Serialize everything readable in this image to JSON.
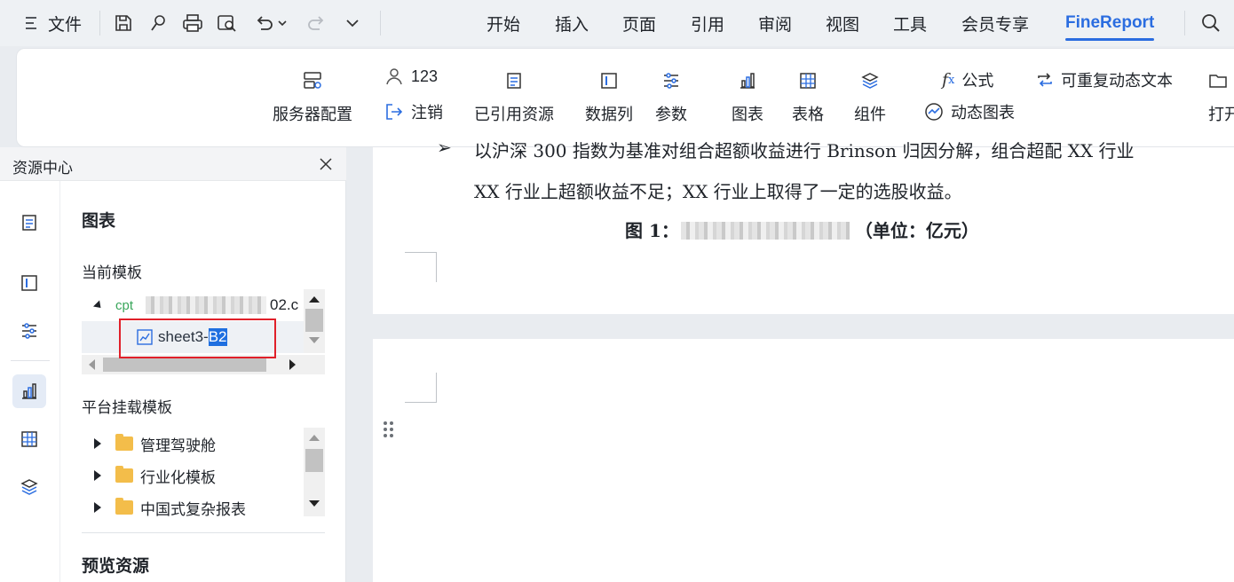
{
  "menubar": {
    "file_label": "文件",
    "tabs": [
      "开始",
      "插入",
      "页面",
      "引用",
      "审阅",
      "视图",
      "工具",
      "会员专享",
      "FineReport"
    ],
    "active_tab": "FineReport"
  },
  "ribbon": {
    "server_config": "服务器配置",
    "user_name": "123",
    "logout": "注销",
    "referenced_resources": "已引用资源",
    "data_column": "数据列",
    "parameter": "参数",
    "chart": "图表",
    "table": "表格",
    "component": "组件",
    "formula": "公式",
    "repeatable_dynamic_text": "可重复动态文本",
    "dynamic_chart": "动态图表",
    "open": "打开"
  },
  "panel": {
    "title": "资源中心",
    "section_title": "图表",
    "current_template_label": "当前模板",
    "cpt_tag": "cpt",
    "cpt_suffix": "02.c",
    "sheet_item_prefix": "sheet3-",
    "sheet_item_selected": "B2",
    "platform_label": "平台挂载模板",
    "folders": [
      "管理驾驶舱",
      "行业化模板",
      "中国式复杂报表"
    ],
    "preview_label": "预览资源"
  },
  "document": {
    "line1_start": "以沪深 300 指数为基准对组合超额收益进行 Brinson 归因分解，组合超配 XX 行业",
    "line2": "XX 行业上超额收益不足；XX 行业上取得了一定的选股收益。",
    "figure_prefix": "图 1：",
    "figure_suffix": "（单位：亿元）"
  },
  "colors": {
    "accent": "#2b6de0",
    "highlight_box": "#e0202a",
    "folder": "#f3bd4a"
  }
}
